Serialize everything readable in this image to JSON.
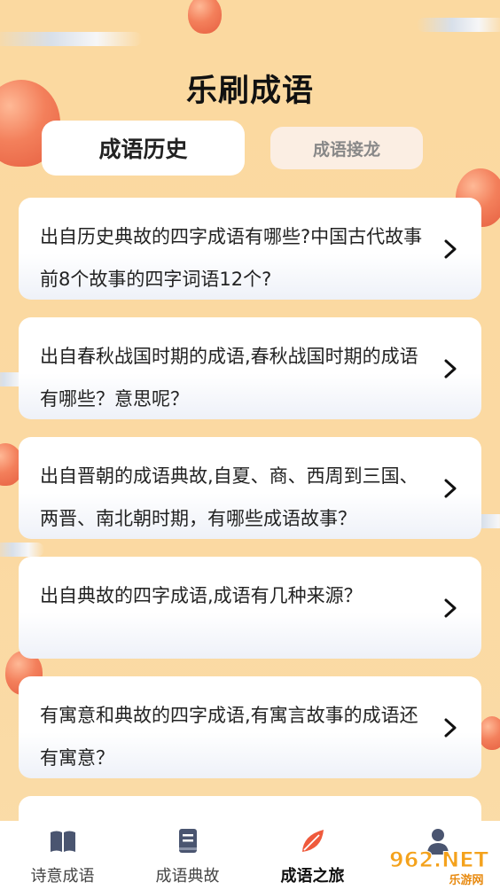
{
  "header": {
    "title": "乐刷成语"
  },
  "tabs": [
    {
      "label": "成语历史",
      "active": true
    },
    {
      "label": "成语接龙",
      "active": false
    }
  ],
  "cards": [
    {
      "text": "出自历史典故的四字成语有哪些?中国古代故事前8个故事的四字词语12个?"
    },
    {
      "text": "出自春秋战国时期的成语,春秋战国时期的成语有哪些？意思呢？"
    },
    {
      "text": "出自晋朝的成语典故,自夏、商、西周到三国、两晋、南北朝时期，有哪些成语故事？"
    },
    {
      "text": "出自典故的四字成语,成语有几种来源？"
    },
    {
      "text": "有寓意和典故的四字成语,有寓言故事的成语还有寓意？"
    },
    {
      "text": ""
    }
  ],
  "bottom_nav": [
    {
      "label": "诗意成语",
      "icon": "book-open-icon",
      "active": false
    },
    {
      "label": "成语典故",
      "icon": "notebook-icon",
      "active": false
    },
    {
      "label": "成语之旅",
      "icon": "leaf-icon",
      "active": true
    },
    {
      "label": "",
      "icon": "user-icon",
      "active": false
    }
  ],
  "watermark": {
    "text": "962.NET",
    "subtext": "乐游网"
  },
  "colors": {
    "accent": "#ef5a3c",
    "background": "#fbd9a0",
    "nav_icon": "#4a5570"
  }
}
